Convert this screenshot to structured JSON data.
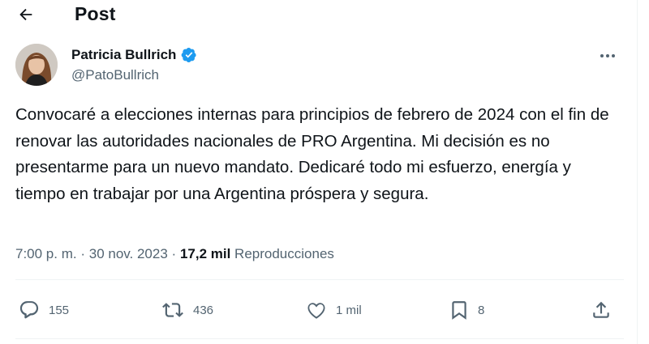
{
  "header": {
    "title": "Post"
  },
  "author": {
    "name": "Patricia Bullrich",
    "handle": "@PatoBullrich"
  },
  "post": {
    "text": "Convocaré a elecciones internas para principios de febrero de 2024 con el fin de renovar las autoridades nacionales de PRO Argentina. Mi decisión es no presentarme para un nuevo mandato. Dedicaré todo mi esfuerzo, energía y tiempo en trabajar por una Argentina próspera y segura.",
    "time": "7:00 p. m.",
    "separator": "·",
    "date": "30 nov. 2023",
    "views_separator": "·",
    "views_count": "17,2 mil",
    "views_label": "Reproducciones"
  },
  "actions": {
    "replies": "155",
    "reposts": "436",
    "likes": "1 mil",
    "bookmarks": "8"
  },
  "icons": {
    "back": "arrow-left-icon",
    "verified": "verified-badge-icon",
    "more": "more-horizontal-icon",
    "reply": "speech-bubble-icon",
    "repost": "repost-arrows-icon",
    "like": "heart-icon",
    "bookmark": "bookmark-icon",
    "share": "share-upload-icon"
  },
  "colors": {
    "text": "#0f1419",
    "secondary": "#536471",
    "verified": "#1d9bf0",
    "divider": "#eff3f4"
  }
}
